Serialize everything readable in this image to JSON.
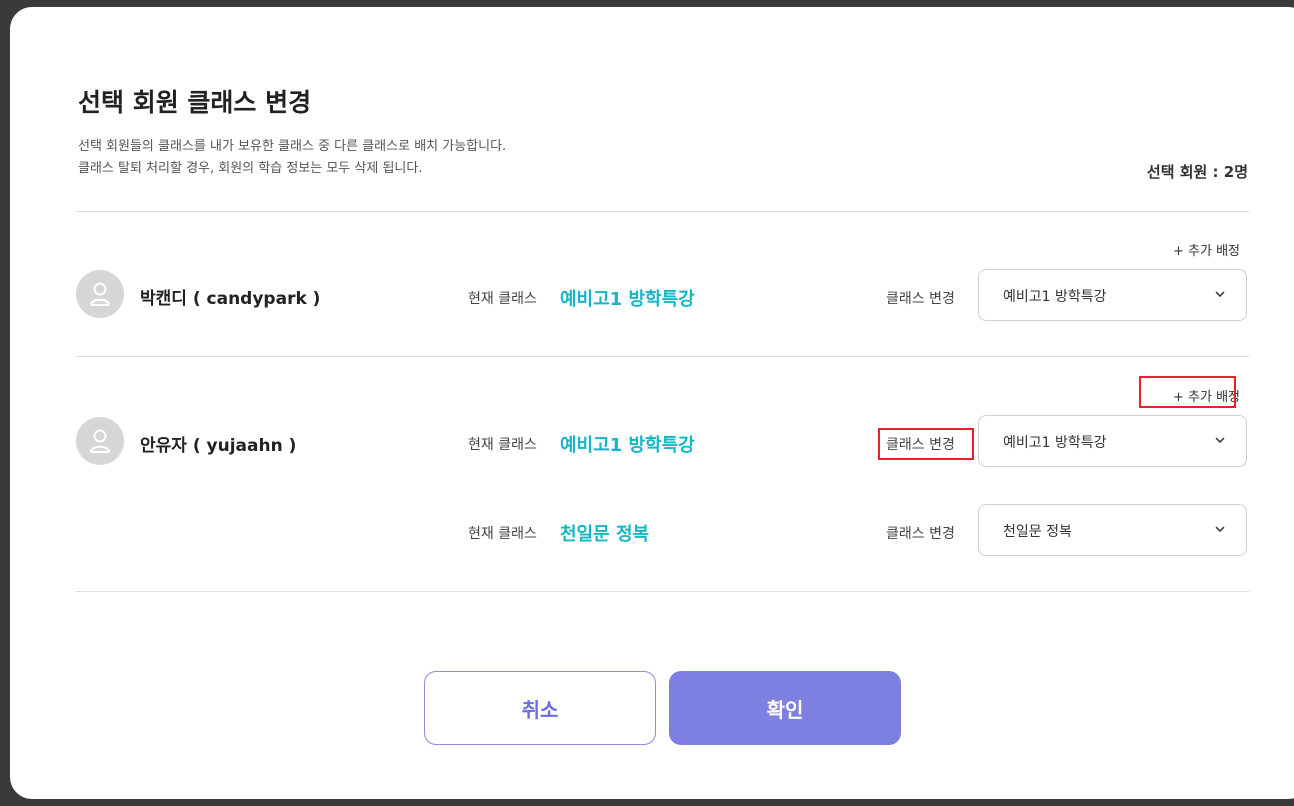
{
  "dialog": {
    "title": "선택 회원 클래스 변경",
    "description_line1": "선택 회원들의 클래스를 내가 보유한 클래스 중 다른 클래스로 배치 가능합니다.",
    "description_line2": "클래스 탈퇴 처리할 경우, 회원의 학습 정보는 모두 삭제 됩니다.",
    "selected_count": "선택 회원 : 2명"
  },
  "labels": {
    "add_assign": "+ 추가 배정",
    "current_class": "현재 클래스",
    "change_class": "클래스 변경"
  },
  "members": [
    {
      "name": "박캔디 ( candypark )",
      "assignments": [
        {
          "current": "예비고1 방학특강",
          "selected": "예비고1 방학특강"
        }
      ]
    },
    {
      "name": "안유자 ( yujaahn )",
      "assignments": [
        {
          "current": "예비고1 방학특강",
          "selected": "예비고1 방학특강"
        },
        {
          "current": "천일문 정복",
          "selected": "천일문 정복"
        }
      ]
    }
  ],
  "buttons": {
    "cancel": "취소",
    "confirm": "확인"
  },
  "colors": {
    "accent_text": "#16b6c6",
    "primary_button": "#7d80e0",
    "highlight_box": "#e8222b"
  },
  "icons": {
    "avatar": "user-icon",
    "dropdown": "chevron-down-icon"
  }
}
